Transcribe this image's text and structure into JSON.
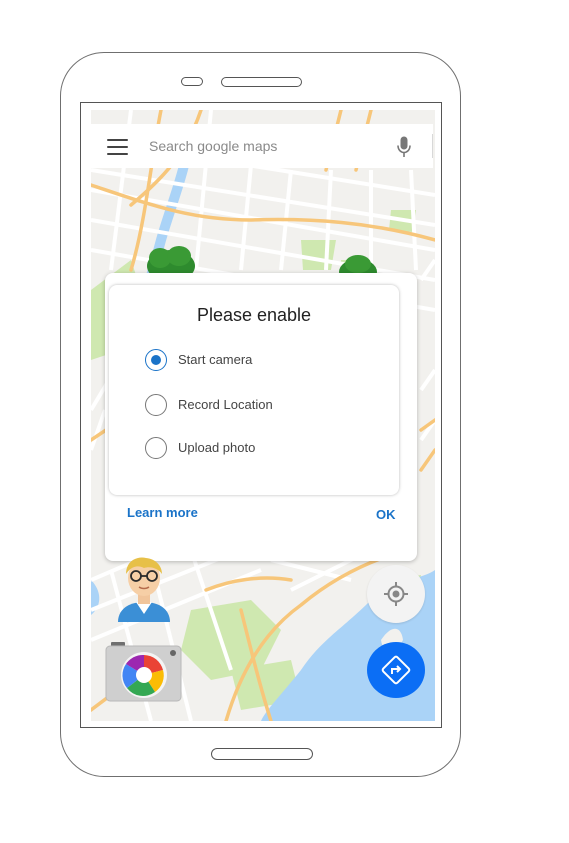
{
  "search": {
    "placeholder": "Search google maps"
  },
  "dialog": {
    "title": "Please enable",
    "options": [
      {
        "label": "Start camera",
        "selected": true
      },
      {
        "label": "Record Location",
        "selected": false
      },
      {
        "label": "Upload photo",
        "selected": false
      }
    ],
    "learn_more_label": "Learn more",
    "ok_label": "OK"
  },
  "colors": {
    "accent": "#1a73c8",
    "fab_primary": "#0b6ef5",
    "map_water": "#aad3f7",
    "map_park": "#c8e6a8",
    "map_road_major": "#f7c67a"
  },
  "icons": {
    "menu": "hamburger-menu-icon",
    "mic": "microphone-icon",
    "locate": "crosshair-locate-icon",
    "directions": "directions-diamond-arrow-icon",
    "camera": "camera-icon",
    "avatar": "user-avatar"
  }
}
